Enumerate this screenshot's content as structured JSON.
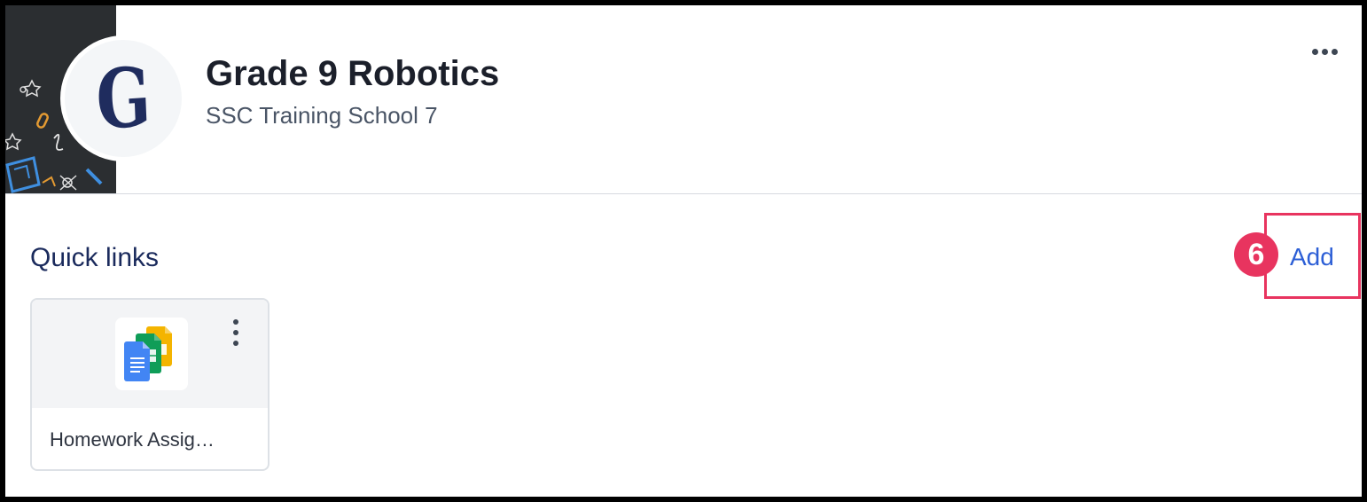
{
  "header": {
    "title": "Grade 9 Robotics",
    "subtitle": "SSC Training School 7",
    "avatar_letter": "G",
    "more_icon": "more-horizontal-icon"
  },
  "quick_links": {
    "title": "Quick links",
    "add_label": "Add",
    "step_badge": "6",
    "items": [
      {
        "label": "Homework Assig…",
        "icon": "google-docs-sheets-slides-icon",
        "menu_icon": "more-vertical-icon"
      }
    ]
  },
  "colors": {
    "highlight": "#e8345f",
    "link": "#2d5fd6",
    "title": "#1b1f2a",
    "section_title": "#1a2a5c"
  }
}
